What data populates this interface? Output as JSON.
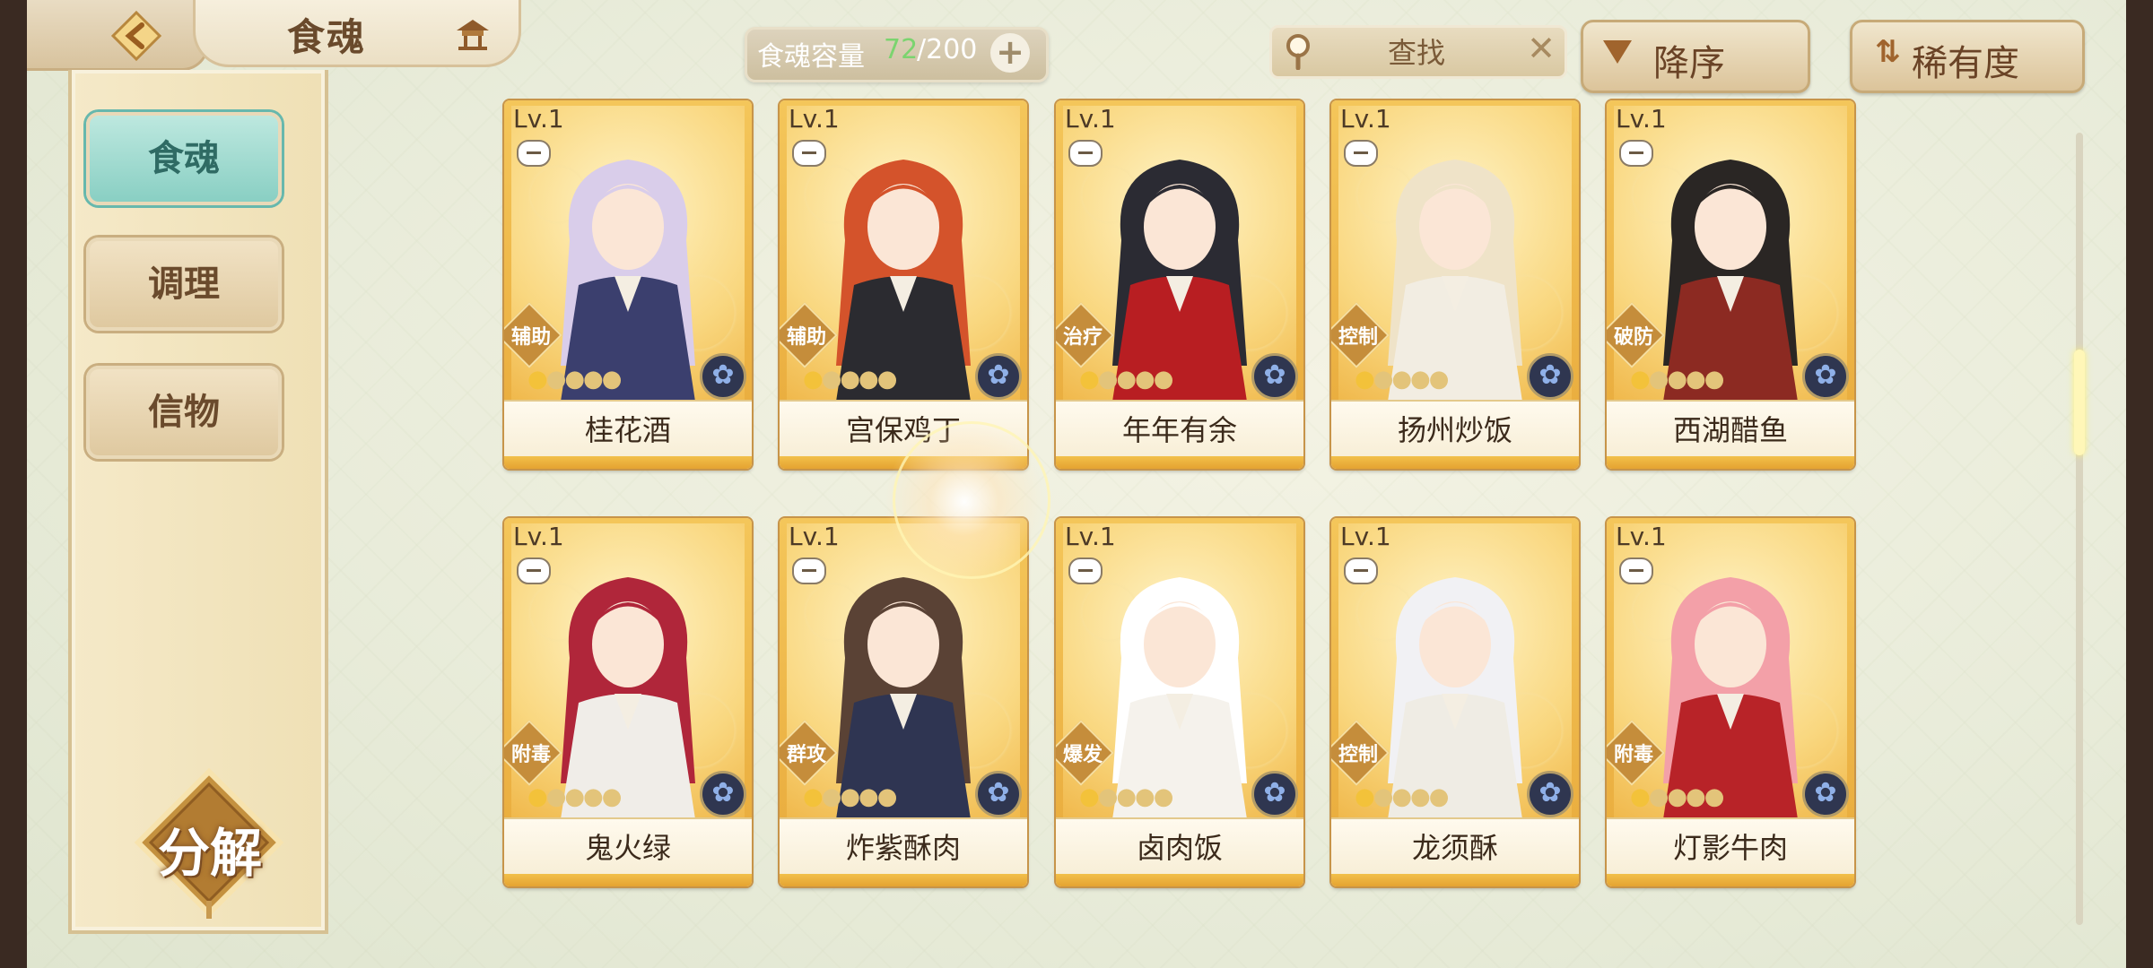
{
  "header": {
    "title": "食魂",
    "capacity_label": "食魂容量",
    "capacity_current": "72",
    "capacity_max": "/200",
    "capacity_add": "+",
    "search_label": "查找",
    "search_clear": "✕",
    "sort_order_label": "降序",
    "sort_key_label": "稀有度"
  },
  "sidebar": {
    "items": [
      {
        "label": "食魂",
        "active": true
      },
      {
        "label": "调理",
        "active": false
      },
      {
        "label": "信物",
        "active": false
      }
    ],
    "decompose_label": "分解"
  },
  "cards": [
    {
      "level": "Lv.1",
      "role": "辅助",
      "name": "桂花酒",
      "stars_filled": 1,
      "stars_total": 5
    },
    {
      "level": "Lv.1",
      "role": "辅助",
      "name": "宫保鸡丁",
      "stars_filled": 1,
      "stars_total": 5
    },
    {
      "level": "Lv.1",
      "role": "治疗",
      "name": "年年有余",
      "stars_filled": 1,
      "stars_total": 5
    },
    {
      "level": "Lv.1",
      "role": "控制",
      "name": "扬州炒饭",
      "stars_filled": 1,
      "stars_total": 5
    },
    {
      "level": "Lv.1",
      "role": "破防",
      "name": "西湖醋鱼",
      "stars_filled": 1,
      "stars_total": 5
    },
    {
      "level": "Lv.1",
      "role": "附毒",
      "name": "鬼火绿",
      "stars_filled": 1,
      "stars_total": 5
    },
    {
      "level": "Lv.1",
      "role": "群攻",
      "name": "炸紫酥肉",
      "stars_filled": 1,
      "stars_total": 5
    },
    {
      "level": "Lv.1",
      "role": "爆发",
      "name": "卤肉饭",
      "stars_filled": 1,
      "stars_total": 5
    },
    {
      "level": "Lv.1",
      "role": "控制",
      "name": "龙须酥",
      "stars_filled": 1,
      "stars_total": 5
    },
    {
      "level": "Lv.1",
      "role": "附毒",
      "name": "灯影牛肉",
      "stars_filled": 1,
      "stars_total": 5
    }
  ],
  "colors": {
    "hair": [
      "#d9cdea",
      "#d4532b",
      "#2b2b33",
      "#efe3c8",
      "#2a2624",
      "#b0263a",
      "#5a4235",
      "#ffffff",
      "#f1f1f4",
      "#f3a0a8"
    ],
    "outfit": [
      "#3b3f6e",
      "#2b2b30",
      "#b81e22",
      "#f2ede2",
      "#8c2a22",
      "#f0ede8",
      "#2f3552",
      "#f5f2ec",
      "#efece4",
      "#b82328"
    ]
  }
}
